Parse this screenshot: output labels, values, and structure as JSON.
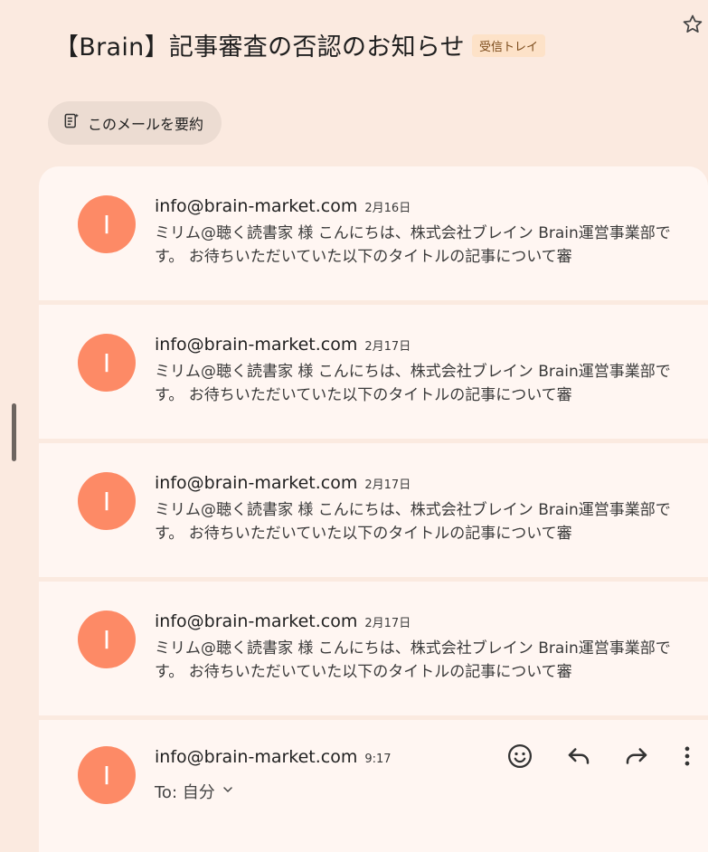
{
  "subject": "【Brain】記事審査の否認のお知らせ",
  "label": "受信トレイ",
  "summarize_button": "このメールを要約",
  "messages": [
    {
      "avatar": "I",
      "sender": "info@brain-market.com",
      "date": "2月16日",
      "snippet": "ミリム@聴く読書家 様 こんにちは、株式会社ブレイン Brain運営事業部です。 お待ちいただいていた以下のタイトルの記事について審"
    },
    {
      "avatar": "I",
      "sender": "info@brain-market.com",
      "date": "2月17日",
      "snippet": "ミリム@聴く読書家 様 こんにちは、株式会社ブレイン Brain運営事業部です。 お待ちいただいていた以下のタイトルの記事について審"
    },
    {
      "avatar": "I",
      "sender": "info@brain-market.com",
      "date": "2月17日",
      "snippet": "ミリム@聴く読書家 様 こんにちは、株式会社ブレイン Brain運営事業部です。 お待ちいただいていた以下のタイトルの記事について審"
    },
    {
      "avatar": "I",
      "sender": "info@brain-market.com",
      "date": "2月17日",
      "snippet": "ミリム@聴く読書家 様 こんにちは、株式会社ブレイン Brain運営事業部です。 お待ちいただいていた以下のタイトルの記事について審"
    }
  ],
  "open_message": {
    "avatar": "I",
    "sender": "info@brain-market.com",
    "time": "9:17",
    "to_label": "To: 自分"
  },
  "icons": {
    "star": "star-icon",
    "summarize": "summarize-icon",
    "emoji": "emoji-icon",
    "reply": "reply-icon",
    "forward": "forward-icon",
    "more": "more-vert-icon",
    "expand": "chevron-down-icon"
  },
  "colors": {
    "background": "#fbeae0",
    "card": "#fff6f2",
    "avatar": "#fd8a66",
    "label_chip": "#fde2c8"
  }
}
